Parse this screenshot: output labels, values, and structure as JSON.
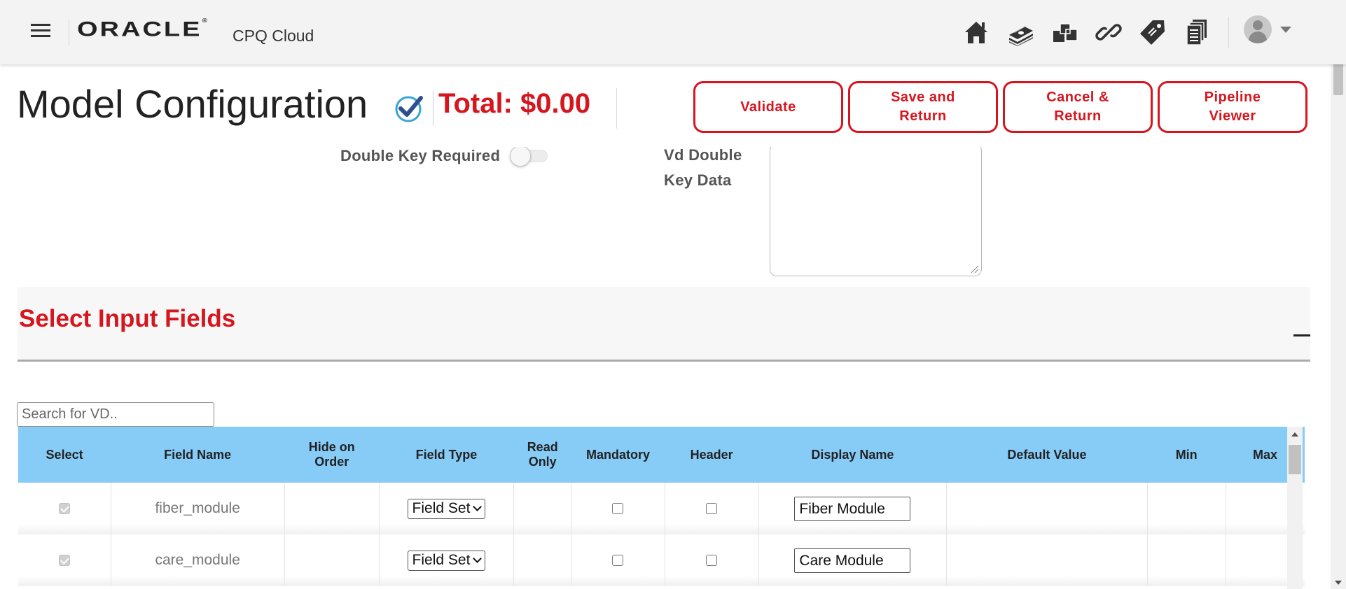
{
  "topbar": {
    "logo": "ORACLE",
    "logo_mark": "®",
    "product": "CPQ Cloud",
    "nav_icons": [
      "home-icon",
      "money-icon",
      "configure-icon",
      "link-icon",
      "tag-icon",
      "documents-icon"
    ]
  },
  "header": {
    "title": "Model Configuration",
    "total": "Total: $0.00",
    "buttons": {
      "validate": "Validate",
      "save_return": "Save and Return",
      "cancel_return": "Cancel & Return",
      "pipeline": "Pipeline Viewer"
    }
  },
  "form": {
    "double_key_label": "Double Key Required",
    "double_key_on": false,
    "vd_double_key_label": "Vd Double Key Data",
    "vd_double_key_value": ""
  },
  "section": {
    "title": "Select Input Fields",
    "collapse_symbol": "—"
  },
  "search": {
    "placeholder": "Search for VD.."
  },
  "table": {
    "headers": [
      "Select",
      "Field Name",
      "Hide on Order",
      "Field Type",
      "Read Only",
      "Mandatory",
      "Header",
      "Display Name",
      "Default Value",
      "Min",
      "Max"
    ],
    "rows": [
      {
        "selected": true,
        "field_name": "fiber_module",
        "field_type": "Field Set",
        "mandatory": false,
        "header": false,
        "display_name": "Fiber Module"
      },
      {
        "selected": true,
        "field_name": "care_module",
        "field_type": "Field Set",
        "mandatory": false,
        "header": false,
        "display_name": "Care Module"
      }
    ]
  },
  "colors": {
    "accent": "#d6161e",
    "table_header": "#87cbf7"
  }
}
